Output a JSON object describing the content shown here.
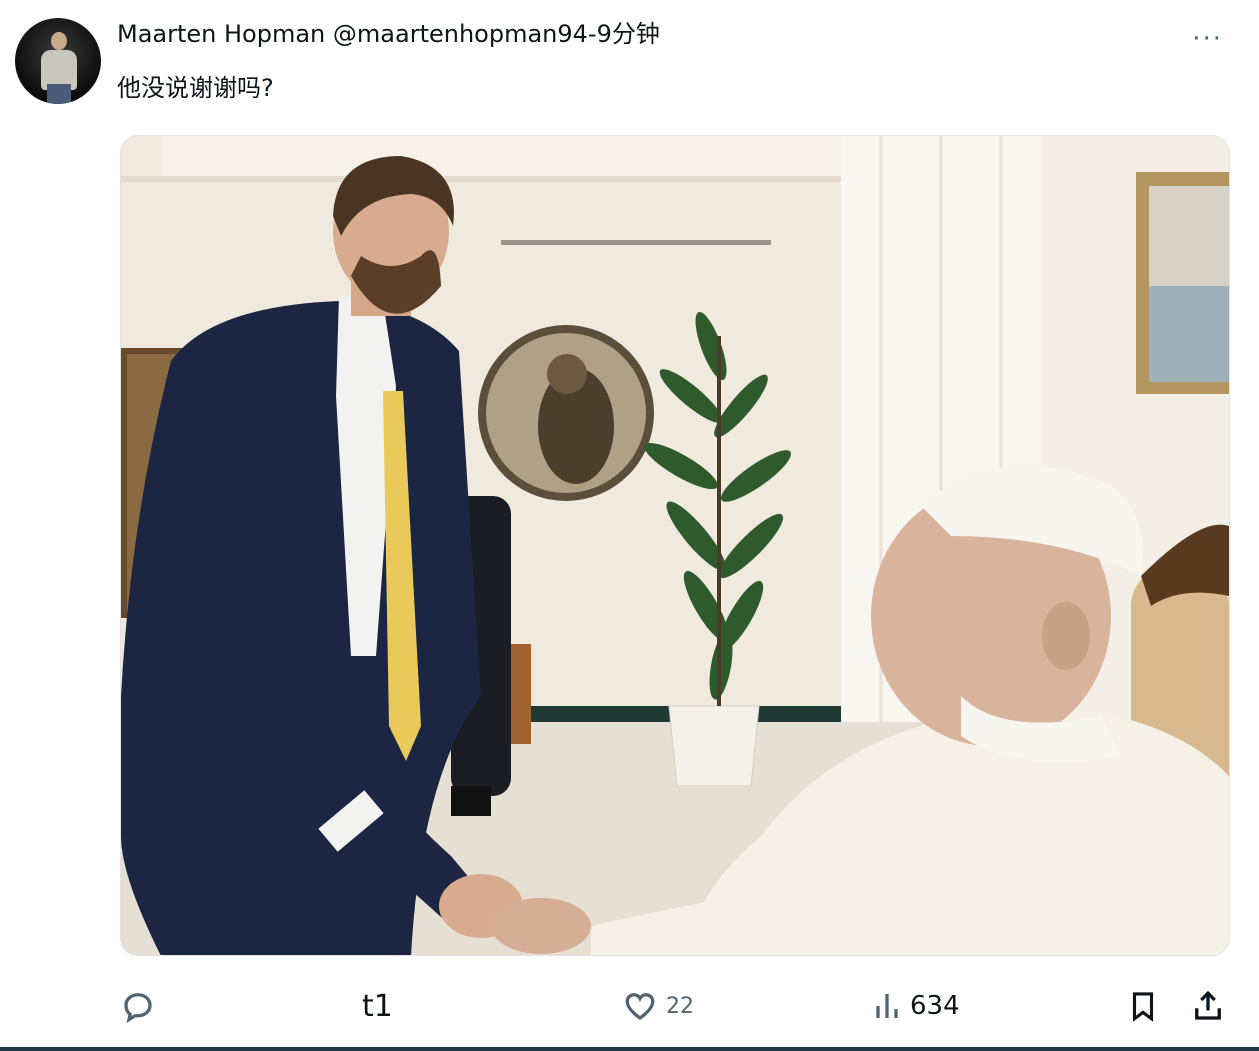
{
  "post": {
    "author_name": "Maarten Hopman",
    "handle_time": "@maartenhopman94-9分钟",
    "text": "他没说谢谢吗?",
    "more_label": "···"
  },
  "actions": {
    "reply_count": "",
    "retweet_label": "t1",
    "like_count": "22",
    "views_count": "634"
  },
  "icons": [
    "reply-icon",
    "retweet-icon",
    "heart-icon",
    "views-icon",
    "bookmark-icon",
    "share-icon"
  ],
  "colors": {
    "icon_gray": "#536471",
    "text": "#0f1419",
    "bottom_bar": "#1f3a44"
  }
}
